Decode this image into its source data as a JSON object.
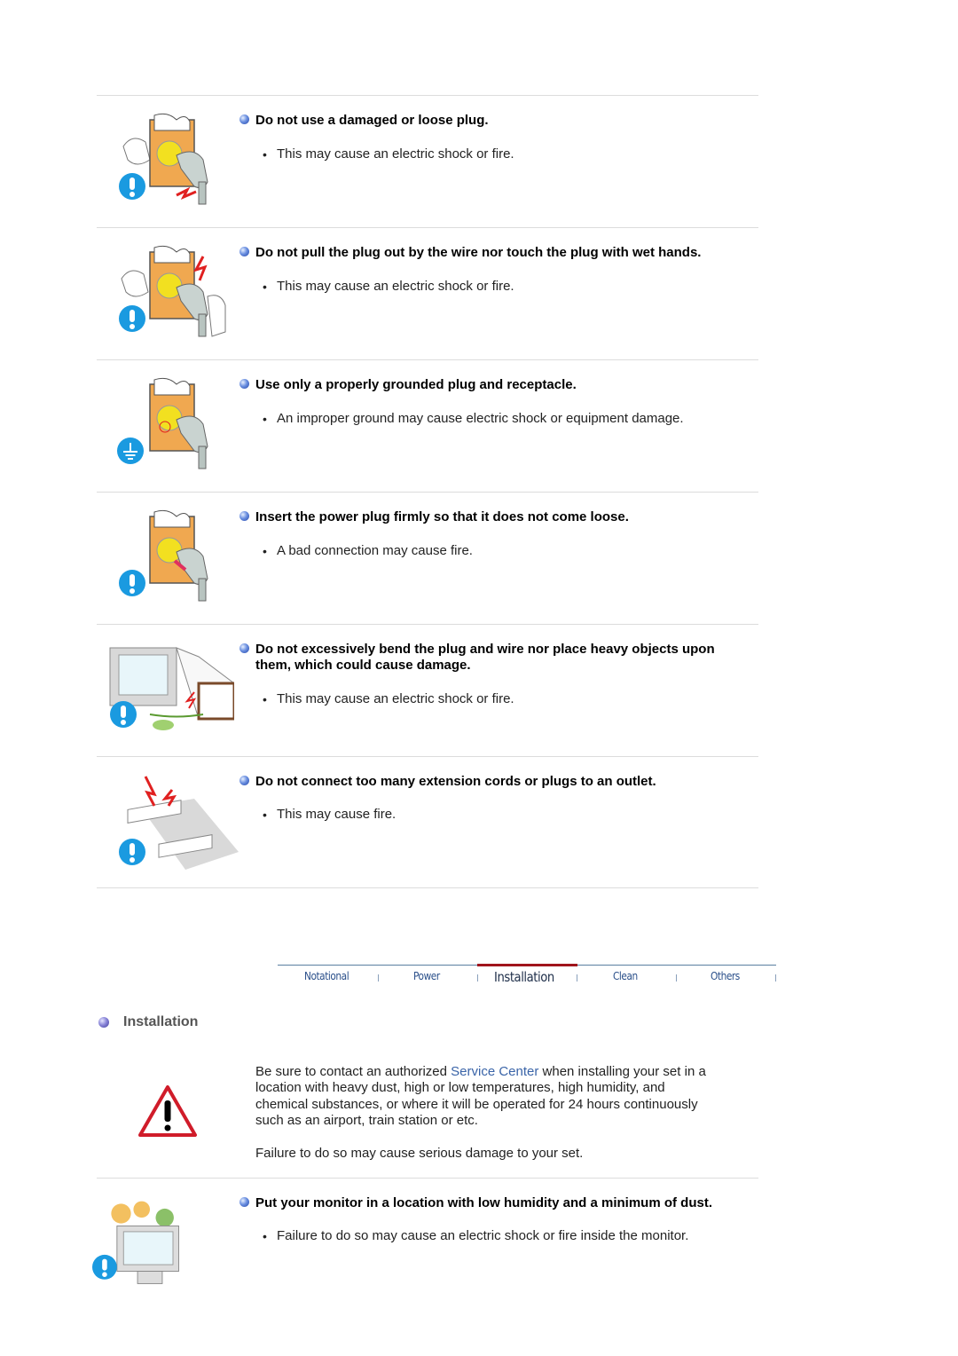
{
  "warnings": [
    {
      "heading": "Do not use a damaged or loose plug.",
      "bullet": "This may cause an electric shock or fire.",
      "icon": "warning-exclamation-icon",
      "illustration": "damaged-plug-illustration"
    },
    {
      "heading": "Do not pull the plug out by the wire nor touch the plug with wet hands.",
      "bullet": "This may cause an electric shock or fire.",
      "icon": "warning-exclamation-icon",
      "illustration": "wet-hands-plug-illustration"
    },
    {
      "heading": "Use only a properly grounded plug and receptacle.",
      "bullet": "An improper ground may cause electric shock or equipment damage.",
      "icon": "ground-symbol-icon",
      "illustration": "grounded-plug-illustration"
    },
    {
      "heading": "Insert the power plug firmly so that it does not come loose.",
      "bullet": "A bad connection may cause fire.",
      "icon": "warning-exclamation-icon",
      "illustration": "insert-plug-illustration"
    },
    {
      "heading_line1": "Do not excessively bend the plug and wire nor place heavy objects upon",
      "heading_line2": "them, which could cause damage.",
      "bullet": "This may cause an electric shock or fire.",
      "icon": "warning-exclamation-icon",
      "illustration": "bent-wire-monitor-illustration"
    },
    {
      "heading": "Do not connect too many extension cords or plugs to an outlet.",
      "bullet": "This may cause fire.",
      "icon": "warning-exclamation-icon",
      "illustration": "overloaded-outlet-illustration"
    }
  ],
  "tabs": [
    {
      "label": "Notational",
      "active": false
    },
    {
      "label": "Power",
      "active": false
    },
    {
      "label": "Installation",
      "active": true
    },
    {
      "label": "Clean",
      "active": false
    },
    {
      "label": "Others",
      "active": false
    }
  ],
  "installation": {
    "title": "Installation",
    "intro_before_link": "Be sure to contact an authorized ",
    "link_text": "Service Center",
    "intro_line1_after": " when installing your set in a",
    "intro_line2": "location with heavy dust, high or low temperatures, high humidity, and",
    "intro_line3": "chemical substances, or where it will be operated for 24 hours continuously",
    "intro_line4": "such as an airport, train station or etc.",
    "failure_note": "Failure to do so may cause serious damage to your set.",
    "warning": {
      "heading": "Put your monitor in a location with low humidity and a minimum of dust.",
      "bullet": "Failure to do so may cause an electric shock or fire inside the monitor."
    }
  },
  "colors": {
    "link": "#3a64a8",
    "active_tab_bar": "#a0141c",
    "warning_blue": "#1a9ae0"
  }
}
